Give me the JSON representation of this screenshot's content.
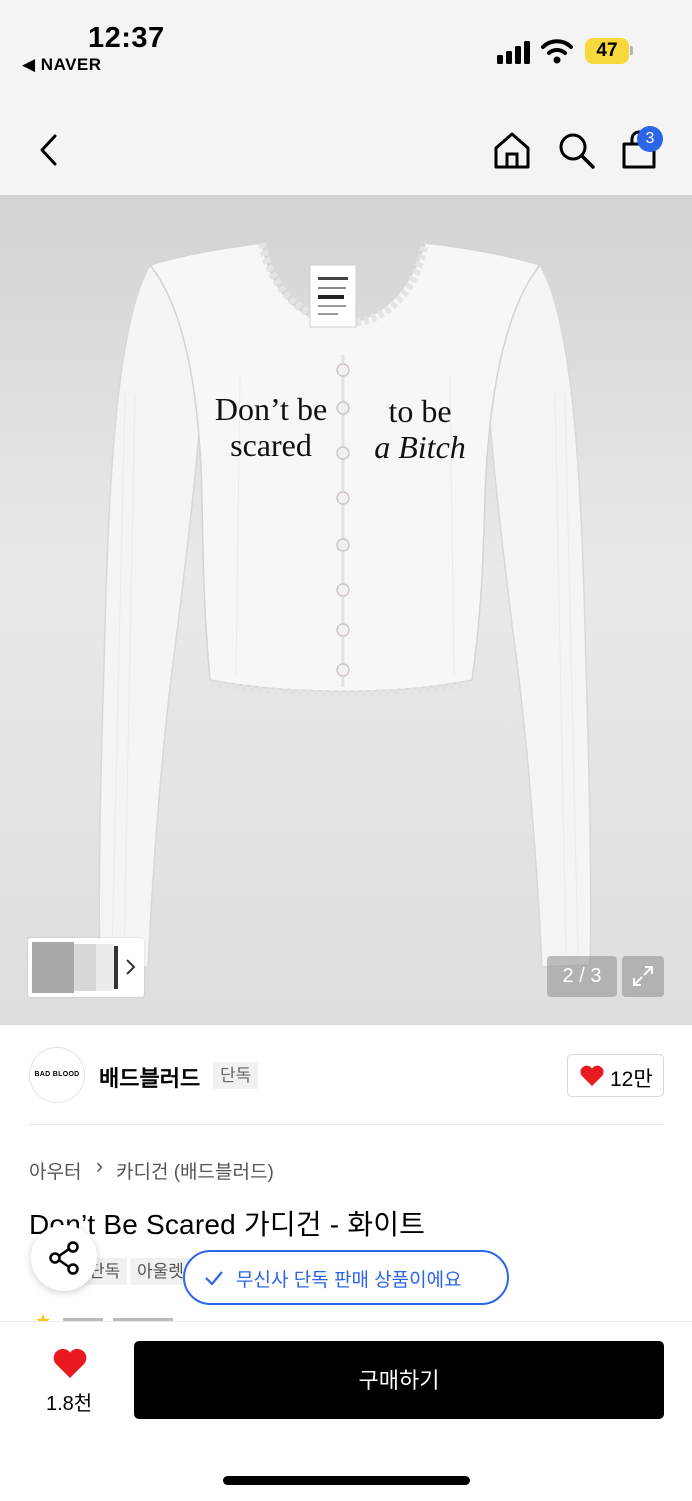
{
  "status": {
    "time": "12:37",
    "back_app": "◀ NAVER",
    "battery": "47"
  },
  "header": {
    "cart_count": "3"
  },
  "product_image": {
    "print_left": [
      "Don’t be",
      "scared"
    ],
    "print_right": [
      "to be",
      "a Bitch"
    ],
    "pager": "2 / 3"
  },
  "brand": {
    "logo_text": "BAD BLOOD",
    "name": "배드블러드",
    "badge": "단독",
    "likes": "12만"
  },
  "breadcrumb": {
    "first": "아우터",
    "sep": "›",
    "second": "카디건 (배드블러드)"
  },
  "product": {
    "title": "Don’t Be Scared 가디건 - 화이트",
    "tags": [
      "단독",
      "아울렛"
    ]
  },
  "toast": {
    "text": "무신사 단독 판매 상품이에요"
  },
  "bottom": {
    "wish_count": "1.8천",
    "buy_label": "구매하기"
  },
  "colors": {
    "accent": "#2b65e8",
    "like_red": "#e8191f",
    "battery_yellow": "#f7d93b"
  },
  "icons": [
    "back-arrow-icon",
    "home-icon",
    "search-icon",
    "shopping-bag-icon",
    "chevron-right-icon",
    "expand-icon",
    "heart-icon",
    "share-icon",
    "check-icon"
  ]
}
